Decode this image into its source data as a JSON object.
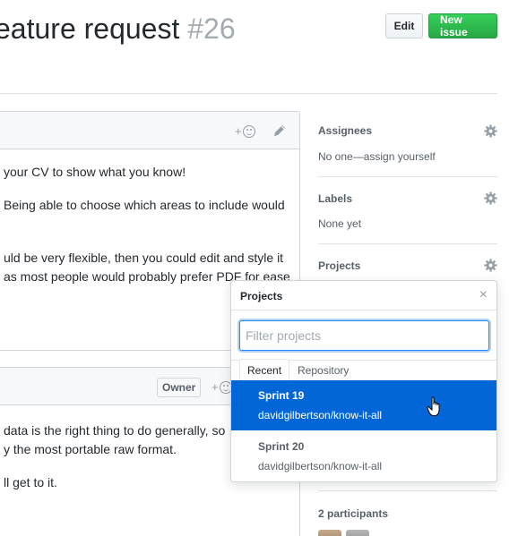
{
  "issue": {
    "title": "eature request",
    "number": "#26"
  },
  "header_buttons": {
    "edit_label": "Edit",
    "new_issue_label": "New issue"
  },
  "comment1": {
    "reaction_plus": "+",
    "lines": [
      "your CV to show what you know!",
      "Being able to choose which areas to include would",
      "uld be very flexible, then you could edit and style it",
      "as most people would probably prefer PDF for ease"
    ]
  },
  "comment2": {
    "owner_label": "Owner",
    "reaction_plus": "+",
    "lines": [
      "data is the right thing to do generally, so",
      "y the most portable raw format.",
      "ll get to it."
    ]
  },
  "sidebar": {
    "assignees": {
      "label": "Assignees",
      "value": "No one—assign yourself"
    },
    "labels": {
      "label": "Labels",
      "value": "None yet"
    },
    "projects": {
      "label": "Projects"
    },
    "participants": {
      "label": "2 participants"
    }
  },
  "projects_popup": {
    "title": "Projects",
    "close": "×",
    "filter_placeholder": "Filter projects",
    "tabs": [
      "Recent",
      "Repository"
    ],
    "items": [
      {
        "name": "Sprint 19",
        "repo": "davidgilbertson/know-it-all",
        "selected": true
      },
      {
        "name": "Sprint 20",
        "repo": "davidgilbertson/know-it-all",
        "selected": false
      }
    ]
  },
  "colors": {
    "accent_blue": "#0366d6",
    "new_issue_green": "#28a745",
    "muted_text": "#586069"
  }
}
